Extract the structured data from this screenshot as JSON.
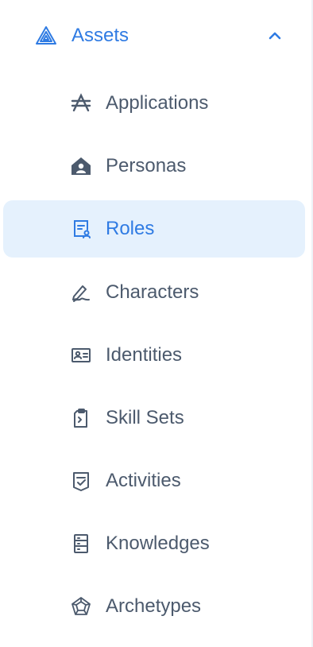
{
  "colors": {
    "accent": "#2f7be3",
    "text": "#4c5a6d",
    "active_bg": "#e5f1fd",
    "icon": "#4c5a6d"
  },
  "section": {
    "label": "Assets",
    "icon": "assets-triangle-icon",
    "expanded": true,
    "chevron_icon": "chevron-up-icon"
  },
  "items": [
    {
      "label": "Applications",
      "icon": "applications-icon",
      "active": false
    },
    {
      "label": "Personas",
      "icon": "personas-icon",
      "active": false
    },
    {
      "label": "Roles",
      "icon": "roles-icon",
      "active": true
    },
    {
      "label": "Characters",
      "icon": "characters-icon",
      "active": false
    },
    {
      "label": "Identities",
      "icon": "identities-icon",
      "active": false
    },
    {
      "label": "Skill Sets",
      "icon": "skill-sets-icon",
      "active": false
    },
    {
      "label": "Activities",
      "icon": "activities-icon",
      "active": false
    },
    {
      "label": "Knowledges",
      "icon": "knowledges-icon",
      "active": false
    },
    {
      "label": "Archetypes",
      "icon": "archetypes-icon",
      "active": false
    }
  ]
}
